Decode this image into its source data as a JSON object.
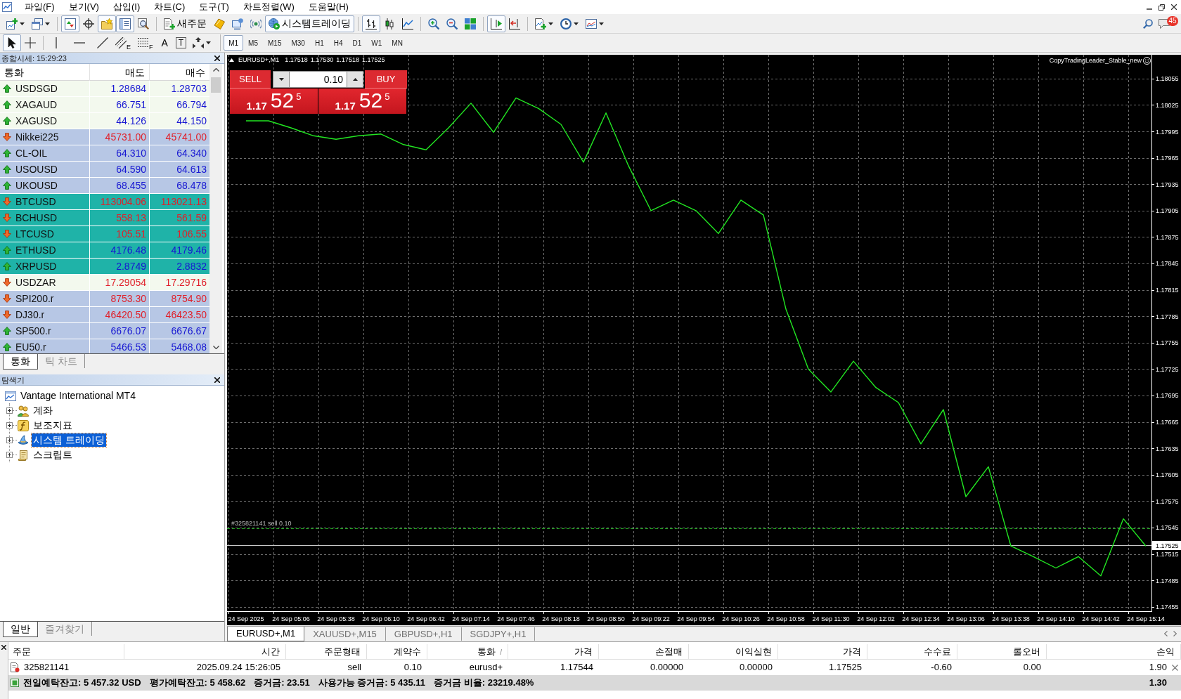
{
  "menu_bar": {
    "items": [
      "파일(F)",
      "보기(V)",
      "삽입(I)",
      "차트(C)",
      "도구(T)",
      "차트정렬(W)",
      "도움말(H)"
    ]
  },
  "toolbar": [
    {
      "kind": "new-chart",
      "pressed": false,
      "dropdown": true
    },
    {
      "kind": "profiles",
      "pressed": false,
      "dropdown": true
    },
    {
      "kind": "separator"
    },
    {
      "kind": "market-watch",
      "pressed": true
    },
    {
      "kind": "data-window",
      "pressed": false
    },
    {
      "kind": "navigator",
      "pressed": true
    },
    {
      "kind": "terminal",
      "pressed": true
    },
    {
      "kind": "tester",
      "pressed": false
    },
    {
      "kind": "separator"
    },
    {
      "kind": "new-order",
      "label": "새주문",
      "pressed": false
    },
    {
      "kind": "editor",
      "pressed": false
    },
    {
      "kind": "market",
      "pressed": false
    },
    {
      "kind": "signals",
      "pressed": false
    },
    {
      "kind": "autotrading",
      "label": "시스템트레이딩",
      "pressed": true
    },
    {
      "kind": "separator"
    },
    {
      "kind": "bars",
      "pressed": true
    },
    {
      "kind": "candles",
      "pressed": false
    },
    {
      "kind": "line",
      "pressed": false
    },
    {
      "kind": "separator"
    },
    {
      "kind": "zoom-in",
      "pressed": false
    },
    {
      "kind": "zoom-out",
      "pressed": false
    },
    {
      "kind": "tile",
      "pressed": false
    },
    {
      "kind": "separator"
    },
    {
      "kind": "chart-shift",
      "pressed": true
    },
    {
      "kind": "autoscroll",
      "pressed": false
    },
    {
      "kind": "separator"
    },
    {
      "kind": "indicators",
      "pressed": false,
      "dropdown": true
    },
    {
      "kind": "periods",
      "pressed": false,
      "dropdown": true
    },
    {
      "kind": "templates",
      "pressed": false,
      "dropdown": true
    }
  ],
  "toolbar_right": {
    "notifications_badge": "45"
  },
  "drawing_tools": [
    {
      "kind": "cursor",
      "pressed": true
    },
    {
      "kind": "crosshair",
      "pressed": false
    },
    {
      "kind": "separator"
    },
    {
      "kind": "vline",
      "pressed": false
    },
    {
      "kind": "hline",
      "pressed": false
    },
    {
      "kind": "trendline",
      "pressed": false
    },
    {
      "kind": "channel",
      "label": "E",
      "pressed": false
    },
    {
      "kind": "fibo",
      "label": "F",
      "pressed": false
    },
    {
      "kind": "text",
      "label": "A",
      "pressed": false
    },
    {
      "kind": "text-label",
      "label": "T",
      "pressed": false
    },
    {
      "kind": "arrows",
      "pressed": false,
      "dropdown": true
    }
  ],
  "periods": [
    {
      "label": "M1",
      "selected": true
    },
    {
      "label": "M5",
      "selected": false
    },
    {
      "label": "M15",
      "selected": false
    },
    {
      "label": "M30",
      "selected": false
    },
    {
      "label": "H1",
      "selected": false
    },
    {
      "label": "H4",
      "selected": false
    },
    {
      "label": "D1",
      "selected": false
    },
    {
      "label": "W1",
      "selected": false
    },
    {
      "label": "MN",
      "selected": false
    }
  ],
  "market_watch": {
    "title": "종합시세: 15:29:23",
    "columns": [
      "통화",
      "매도",
      "매수"
    ],
    "rows": [
      {
        "symbol": "USDSGD",
        "bid": "1.28684",
        "ask": "1.28703",
        "kind": "up",
        "color": "#f3f9ee"
      },
      {
        "symbol": "XAGAUD",
        "bid": "66.751",
        "ask": "66.794",
        "kind": "up",
        "color": "#f3f9ee"
      },
      {
        "symbol": "XAGUSD",
        "bid": "44.126",
        "ask": "44.150",
        "kind": "up",
        "color": "#f3f9ee"
      },
      {
        "symbol": "Nikkei225",
        "bid": "45731.00",
        "ask": "45741.00",
        "kind": "down",
        "color": "#b7c7e5"
      },
      {
        "symbol": "CL-OIL",
        "bid": "64.310",
        "ask": "64.340",
        "kind": "up",
        "color": "#b7c7e5"
      },
      {
        "symbol": "USOUSD",
        "bid": "64.590",
        "ask": "64.613",
        "kind": "up",
        "color": "#b7c7e5"
      },
      {
        "symbol": "UKOUSD",
        "bid": "68.455",
        "ask": "68.478",
        "kind": "up",
        "color": "#b7c7e5"
      },
      {
        "symbol": "BTCUSD",
        "bid": "113004.06",
        "ask": "113021.13",
        "kind": "down",
        "color": "#1fb3a8"
      },
      {
        "symbol": "BCHUSD",
        "bid": "558.13",
        "ask": "561.59",
        "kind": "down",
        "color": "#1fb3a8"
      },
      {
        "symbol": "LTCUSD",
        "bid": "105.51",
        "ask": "106.55",
        "kind": "down",
        "color": "#1fb3a8"
      },
      {
        "symbol": "ETHUSD",
        "bid": "4176.48",
        "ask": "4179.46",
        "kind": "up",
        "color": "#1fb3a8"
      },
      {
        "symbol": "XRPUSD",
        "bid": "2.8749",
        "ask": "2.8832",
        "kind": "up",
        "color": "#1fb3a8"
      },
      {
        "symbol": "USDZAR",
        "bid": "17.29054",
        "ask": "17.29716",
        "kind": "down",
        "color": "#f3f9ee"
      },
      {
        "symbol": "SPI200.r",
        "bid": "8753.30",
        "ask": "8754.90",
        "kind": "down",
        "color": "#b7c7e5"
      },
      {
        "symbol": "DJ30.r",
        "bid": "46420.50",
        "ask": "46423.50",
        "kind": "down",
        "color": "#b7c7e5"
      },
      {
        "symbol": "SP500.r",
        "bid": "6676.07",
        "ask": "6676.67",
        "kind": "up",
        "color": "#b7c7e5"
      },
      {
        "symbol": "EU50.r",
        "bid": "5466.53",
        "ask": "5468.08",
        "kind": "up",
        "color": "#b7c7e5"
      }
    ],
    "tabs": [
      {
        "label": "통화",
        "selected": true
      },
      {
        "label": "틱 차트",
        "selected": false
      }
    ]
  },
  "navigator": {
    "title": "탐색기",
    "tree": [
      {
        "label": "Vantage International MT4",
        "kind": "root",
        "selected": false,
        "children": [
          {
            "label": "계좌",
            "kind": "accounts",
            "expanded": false,
            "selected": false
          },
          {
            "label": "보조지표",
            "kind": "indicators",
            "expanded": false,
            "selected": false
          },
          {
            "label": "시스템 트레이딩",
            "kind": "experts",
            "expanded": false,
            "selected": true
          },
          {
            "label": "스크립트",
            "kind": "scripts",
            "expanded": false,
            "selected": false
          }
        ]
      }
    ],
    "tabs": [
      {
        "label": "일반",
        "selected": true
      },
      {
        "label": "즐겨찾기",
        "selected": false
      }
    ]
  },
  "chart": {
    "header": {
      "symbol": "EURUSD+,M1",
      "ohlc": [
        "1.17518",
        "1.17530",
        "1.17518",
        "1.17525"
      ]
    },
    "one_click": {
      "sell_label": "SELL",
      "buy_label": "BUY",
      "lots": "0.10",
      "sell_price": {
        "prefix": "1.17",
        "pips": "52",
        "point": "5"
      },
      "buy_price": {
        "prefix": "1.17",
        "pips": "52",
        "point": "5"
      }
    },
    "expert": "CopyTradingLeader_Stable_new",
    "chart_data": {
      "type": "line",
      "grid": true,
      "categories": [
        "24 Sep 2025",
        null,
        "24 Sep 05:06",
        null,
        "24 Sep 05:38",
        null,
        "24 Sep 06:10",
        null,
        "24 Sep 06:42",
        null,
        "24 Sep 07:14",
        null,
        "24 Sep 07:46",
        null,
        "24 Sep 08:18",
        null,
        "24 Sep 08:50",
        null,
        "24 Sep 09:22",
        null,
        "24 Sep 09:54",
        null,
        "24 Sep 10:26",
        null,
        "24 Sep 10:58",
        null,
        "24 Sep 11:30",
        null,
        "24 Sep 12:02",
        null,
        "24 Sep 12:34",
        null,
        "24 Sep 13:06",
        null,
        "24 Sep 13:38",
        null,
        "24 Sep 14:10",
        null,
        "24 Sep 14:42",
        null,
        "24 Sep 15:14"
      ],
      "series": [
        {
          "color": "#22e622",
          "values": [
            1.18007,
            1.18007,
            1.17999,
            1.1799,
            1.17986,
            1.1799,
            1.17992,
            1.1798,
            1.17974,
            1.17999,
            1.18027,
            1.17994,
            1.18033,
            1.18021,
            1.18003,
            1.1796,
            1.18016,
            1.17956,
            1.17905,
            1.17917,
            1.17905,
            1.17879,
            1.17917,
            1.179,
            1.17793,
            1.17725,
            1.17699,
            1.17734,
            1.17704,
            1.17687,
            1.1764,
            1.17679,
            1.1758,
            1.17614,
            1.17524,
            1.17512,
            1.17499,
            1.17512,
            1.1749,
            1.17555,
            1.17524
          ]
        }
      ],
      "ylim": [
        1.17434,
        1.18082
      ],
      "yticks": [
        1.18055,
        1.18025,
        1.17995,
        1.17965,
        1.17935,
        1.17905,
        1.17875,
        1.17845,
        1.17815,
        1.17785,
        1.17755,
        1.17725,
        1.17695,
        1.17665,
        1.17635,
        1.17605,
        1.17575,
        1.17545,
        1.17515,
        1.17485,
        1.17455
      ],
      "ref_lines": [
        {
          "axis": "y",
          "value": 1.17544,
          "color": "#1fa01f"
        },
        {
          "axis": "y",
          "value": 1.17525,
          "label": "1.17525",
          "color": "#c8c8c8"
        }
      ],
      "annotations": [
        {
          "text": "#325821141 sell 0.10",
          "y": 1.17544
        }
      ]
    }
  },
  "chart_tabs": [
    {
      "label": "EURUSD+,M1",
      "selected": true
    },
    {
      "label": "XAUUSD+,M15",
      "selected": false
    },
    {
      "label": "GBPUSD+,H1",
      "selected": false
    },
    {
      "label": "SGDJPY+,H1",
      "selected": false
    }
  ],
  "terminal": {
    "columns": [
      {
        "label": "주문"
      },
      {
        "label": "시간"
      },
      {
        "label": "주문형태"
      },
      {
        "label": "계약수"
      },
      {
        "label": "통화",
        "sort_mark": "/"
      },
      {
        "label": "가격"
      },
      {
        "label": "손절매"
      },
      {
        "label": "이익실현"
      },
      {
        "label": "가격"
      },
      {
        "label": "수수료"
      },
      {
        "label": "롤오버"
      },
      {
        "label": "손익"
      }
    ],
    "rows": [
      {
        "cells": [
          "325821141",
          "2025.09.24 15:26:05",
          "sell",
          "0.10",
          "eurusd+",
          "1.17544",
          "0.00000",
          "0.00000",
          "1.17525",
          "-0.60",
          "0.00",
          "1.90"
        ]
      }
    ],
    "summary": {
      "items": [
        "전일예탁잔고: 5 457.32 USD",
        "평가예탁잔고: 5 458.62",
        "증거금: 23.51",
        "사용가능 증거금: 5 435.11",
        "증거금 비율: 23219.48%"
      ],
      "profit": "1.30"
    }
  }
}
